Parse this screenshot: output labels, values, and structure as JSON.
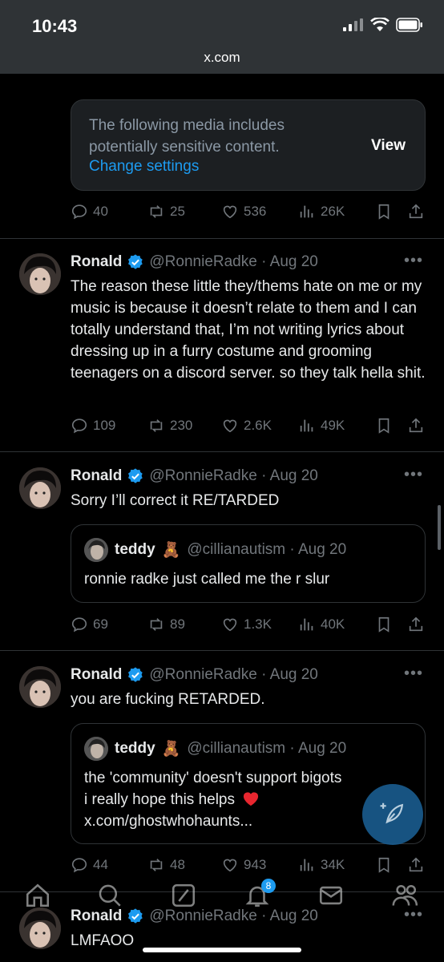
{
  "status": {
    "time": "10:43",
    "url": "x.com"
  },
  "sensitive": {
    "text": "The following media includes potentially sensitive content.",
    "link": "Change settings",
    "view": "View"
  },
  "tweet0_actions": {
    "replies": "40",
    "reposts": "25",
    "likes": "536",
    "views": "26K"
  },
  "tweets": [
    {
      "name": "Ronald",
      "handle": "@RonnieRadke · Aug 20",
      "text": "The reason these little they/thems hate on me or my music is because it doesn’t relate to them and I can totally understand that, I’m not writing lyrics about dressing up in a furry costume and grooming teenagers on a discord server. so they talk hella shit.",
      "actions": {
        "replies": "109",
        "reposts": "230",
        "likes": "2.6K",
        "views": "49K"
      }
    },
    {
      "name": "Ronald",
      "handle": "@RonnieRadke · Aug 20",
      "text": "Sorry I’ll correct it RE/TARDED",
      "quote": {
        "name": "teddy",
        "emoji": "🧸",
        "handle": "@cillianautism · Aug 20",
        "text": "ronnie radke just called me the r slur"
      },
      "actions": {
        "replies": "69",
        "reposts": "89",
        "likes": "1.3K",
        "views": "40K"
      }
    },
    {
      "name": "Ronald",
      "handle": "@RonnieRadke · Aug 20",
      "text": "you are fucking RETARDED.",
      "quote": {
        "name": "teddy",
        "emoji": "🧸",
        "handle": "@cillianautism · Aug 20",
        "text": "the 'community' doesn't support bigots i really hope this helps",
        "link": "x.com/ghostwhohaunts..."
      },
      "actions": {
        "replies": "44",
        "reposts": "48",
        "likes": "943",
        "views": "34K"
      }
    },
    {
      "name": "Ronald",
      "handle": "@RonnieRadke · Aug 20",
      "text": "LMFAOO"
    }
  ],
  "nav": {
    "notifications_badge": "8"
  },
  "colors": {
    "accent": "#1d9bf0",
    "background": "#000000",
    "muted": "#71767b",
    "heart": "#f91880"
  },
  "icons": [
    "reply-icon",
    "repost-icon",
    "like-icon",
    "views-icon",
    "bookmark-icon",
    "share-icon",
    "verified-icon",
    "home-icon",
    "search-icon",
    "grok-icon",
    "notifications-icon",
    "messages-icon",
    "communities-icon",
    "compose-icon"
  ]
}
